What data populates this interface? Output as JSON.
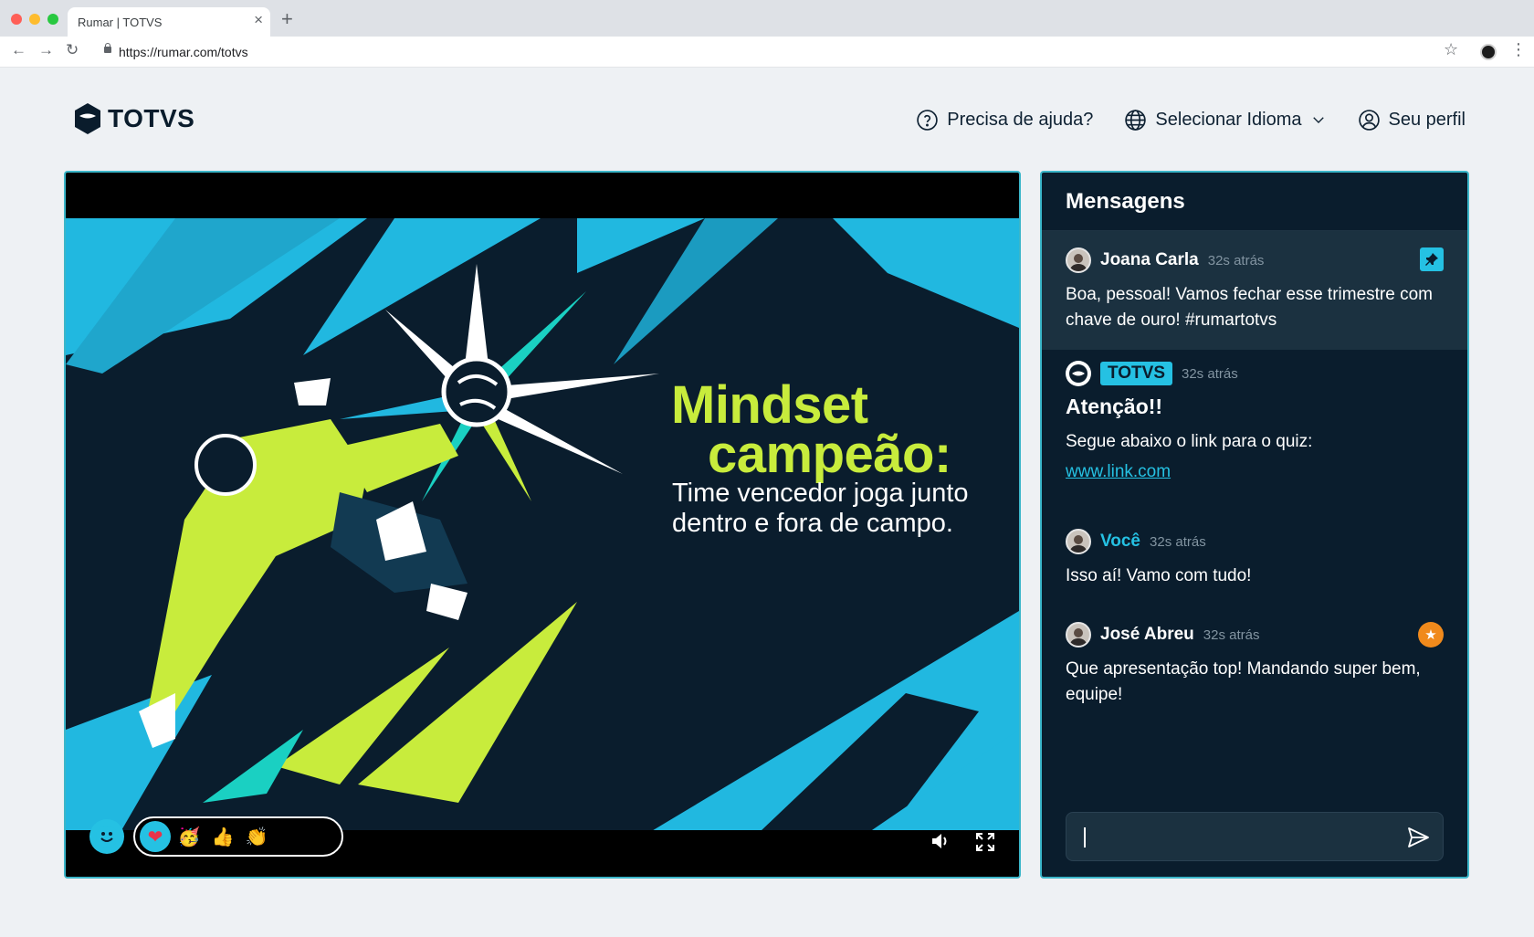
{
  "browser": {
    "tab_title": "Rumar | TOTVS",
    "tab_close": "×",
    "new_tab": "+",
    "url": "https://rumar.com/totvs",
    "back": "←",
    "forward": "→",
    "reload": "↻",
    "bookmark": "☆",
    "menu": "⋮"
  },
  "header": {
    "logo_text": "TOTVS",
    "help_label": "Precisa de ajuda?",
    "language_label": "Selecionar Idioma",
    "profile_label": "Seu perfil"
  },
  "video": {
    "headline_line1": "Mindset",
    "headline_line2": "campeão:",
    "subline": "Time vencedor joga junto dentro e fora de campo.",
    "reactions": [
      "❤",
      "🥳",
      "👍",
      "👏",
      "😮",
      "😂"
    ],
    "active_reaction": "❤"
  },
  "chat": {
    "title": "Mensagens",
    "messages": [
      {
        "author": "Joana Carla",
        "time": "32s atrás",
        "text": "Boa, pessoal! Vamos fechar esse trimestre com chave de ouro! #rumartotvs",
        "pinned": true
      },
      {
        "author": "TOTVS",
        "time": "32s atrás",
        "title": "Atenção!!",
        "text": "Segue abaixo o link para o quiz:",
        "link": "www.link.com"
      },
      {
        "author": "Você",
        "time": "32s atrás",
        "text": "Isso aí! Vamo com tudo!"
      },
      {
        "author": "José Abreu",
        "time": "32s atrás",
        "text": "Que apresentação top! Mandando super bem, equipe!",
        "badge": "★"
      }
    ],
    "input_value": ""
  },
  "colors": {
    "accent": "#25c1e3",
    "lime": "#c8ec3c",
    "panel": "#0a1d2d",
    "pinned_bg": "#1b3140",
    "badge_orange": "#f08a1c"
  }
}
